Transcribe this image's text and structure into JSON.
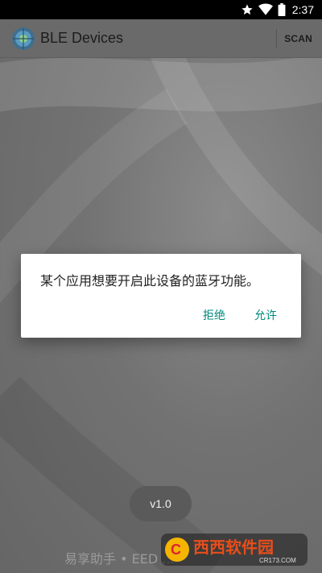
{
  "status_bar": {
    "time": "2:37",
    "icons": [
      "star-icon",
      "wifi-icon",
      "battery-icon"
    ]
  },
  "app_bar": {
    "title": "BLE Devices",
    "scan_label": "SCAN"
  },
  "dialog": {
    "message": "某个应用想要开启此设备的蓝牙功能。",
    "deny_label": "拒绝",
    "allow_label": "允许"
  },
  "version": "v1.0",
  "watermark": {
    "text": "易享助手 • EED ...",
    "site_logo_text": "西西软件园",
    "site_logo_url_text": "CR173.COM"
  },
  "colors": {
    "accent_button": "#00897b",
    "dialog_bg": "#ffffff",
    "app_bar_bg": "#6a6a6a",
    "status_bar_bg": "#000000"
  }
}
